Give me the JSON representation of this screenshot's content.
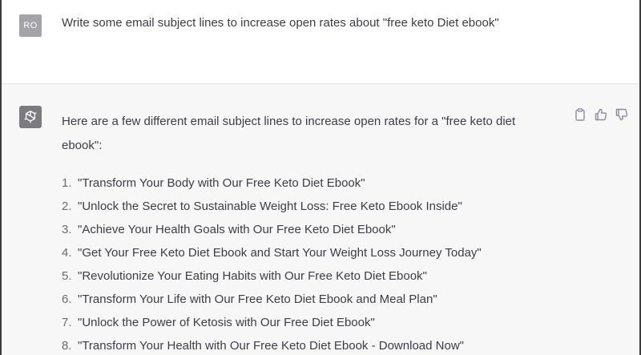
{
  "user_message": {
    "avatar_initials": "RO",
    "text": "Write some email subject lines to increase open rates about \"free keto Diet ebook\""
  },
  "assistant_message": {
    "avatar_icon": "openai-logo-icon",
    "intro": "Here are a few different email subject lines to increase open rates for a \"free keto diet ebook\":",
    "items": [
      {
        "num": "1.",
        "text": "\"Transform Your Body with Our Free Keto Diet Ebook\""
      },
      {
        "num": "2.",
        "text": "\"Unlock the Secret to Sustainable Weight Loss: Free Keto Ebook Inside\""
      },
      {
        "num": "3.",
        "text": "\"Achieve Your Health Goals with Our Free Keto Diet Ebook\""
      },
      {
        "num": "4.",
        "text": "\"Get Your Free Keto Diet Ebook and Start Your Weight Loss Journey Today\""
      },
      {
        "num": "5.",
        "text": "\"Revolutionize Your Eating Habits with Our Free Keto Diet Ebook\""
      },
      {
        "num": "6.",
        "text": "\"Transform Your Life with Our Free Keto Diet Ebook and Meal Plan\""
      },
      {
        "num": "7.",
        "text": "\"Unlock the Power of Ketosis with Our Free Diet Ebook\""
      },
      {
        "num": "8.",
        "text": "\"Transform Your Health with Our Free Keto Diet Ebook - Download Now\""
      }
    ],
    "actions": [
      "clipboard-icon",
      "thumbs-up-icon",
      "thumbs-down-icon"
    ]
  },
  "colors": {
    "user_bg": "#ffffff",
    "assistant_bg": "#f7f7f8",
    "user_avatar": "#a3a3a8",
    "bot_avatar": "#7a7a7f",
    "text": "#3c3c46"
  }
}
